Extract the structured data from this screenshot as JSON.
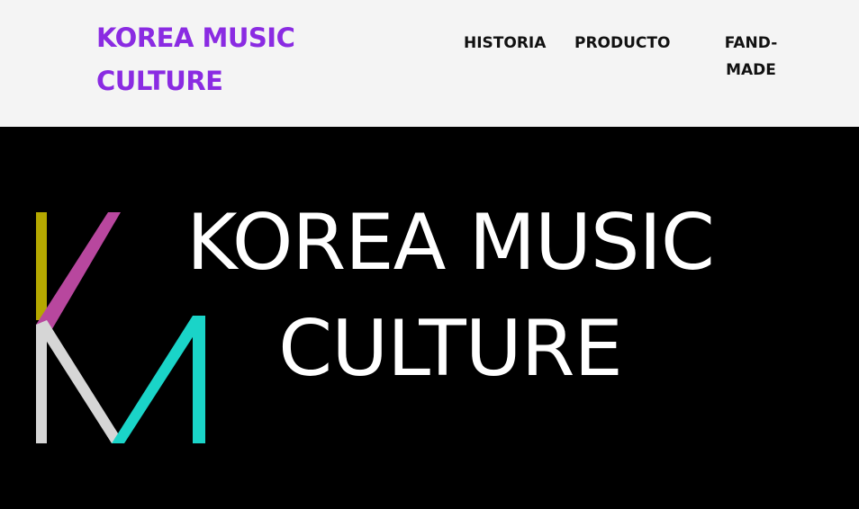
{
  "header": {
    "brand": "KOREA MUSIC CULTURE",
    "nav": [
      {
        "label": "HISTORIA"
      },
      {
        "label": "PRODUCTO"
      },
      {
        "label": "FAND-\nMADE"
      }
    ]
  },
  "hero": {
    "title": "KOREA MUSIC\nCULTURE",
    "logo_icon": "km-monogram-logo",
    "logo_colors": {
      "k_stem": "#b5a800",
      "k_arm": "#b8479e",
      "m_left": "#d6d6d6",
      "m_right": "#1ad4c8"
    }
  },
  "colors": {
    "brand": "#8a2be2",
    "header_bg": "#f4f4f4",
    "hero_bg": "#000000"
  }
}
